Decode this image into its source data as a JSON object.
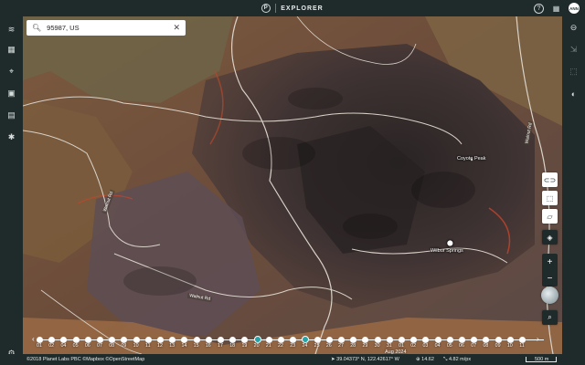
{
  "header": {
    "brand_letter": "P",
    "app_name": "EXPLORER",
    "avatar_initials": "ANN"
  },
  "search": {
    "value": "95987, US"
  },
  "left_rail": {
    "items": [
      "layers-stack-icon",
      "mosaic-grid-icon",
      "location-pin-icon",
      "image-gallery-icon",
      "report-doc-icon",
      "analytics-icon"
    ],
    "settings": "settings-icon"
  },
  "right_rail": {
    "items": [
      "compare-icon",
      "export-icon",
      "crop-icon",
      "contrast-icon"
    ]
  },
  "map": {
    "labels": {
      "coyote_peak": "Coyote Peak",
      "wilbur_springs": "Wilbur Springs"
    },
    "road_labels": {
      "left": "Walnut Rd",
      "bottom": "Walnut Rd",
      "right": "Walnut Rd"
    }
  },
  "timeline": {
    "days": [
      "01",
      "02",
      "04",
      "05",
      "06",
      "07",
      "08",
      "09",
      "10",
      "11",
      "12",
      "13",
      "14",
      "15",
      "16",
      "17",
      "18",
      "19",
      "20",
      "21",
      "22",
      "23",
      "24",
      "25",
      "26",
      "27",
      "28",
      "29",
      "30",
      "31",
      "01",
      "02",
      "03",
      "04",
      "05",
      "06",
      "07",
      "08",
      "09",
      "10",
      "11"
    ],
    "selected": [
      "20",
      "24"
    ],
    "month": "Aug 2024"
  },
  "footer": {
    "attribution": "©2018 Planet Labs PBC  ©Mapbox  ©OpenStreetMap",
    "coordinates": "39.04373° N, 122.42617° W",
    "zoom": "14.62",
    "resolution": "4.82 m/px",
    "scale": "500 m"
  }
}
